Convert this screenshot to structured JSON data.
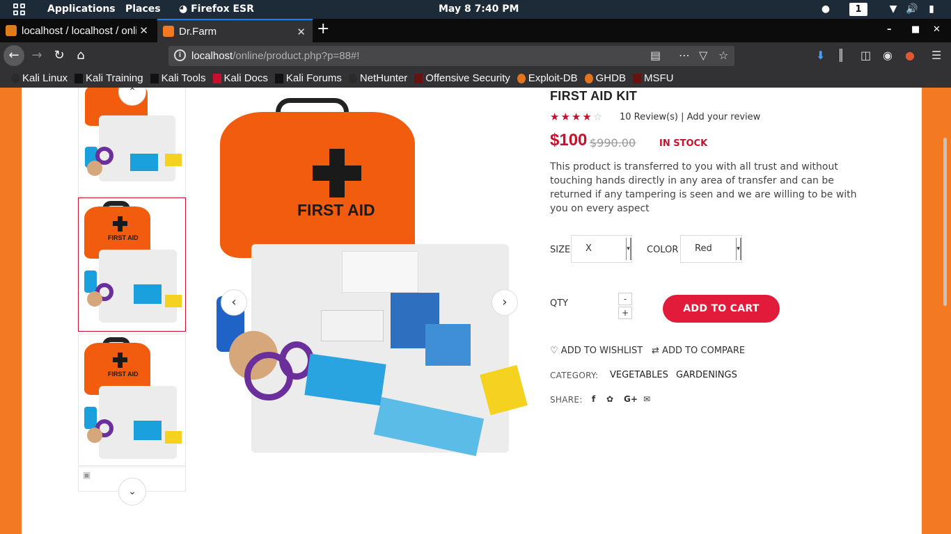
{
  "system_bar": {
    "menus": [
      "Applications",
      "Places",
      "Firefox ESR"
    ],
    "clock": "May 8   7:40 PM",
    "workspace": "1"
  },
  "browser": {
    "tabs": [
      {
        "title": "localhost / localhost / online",
        "active": false
      },
      {
        "title": "Dr.Farm",
        "active": true
      }
    ],
    "url_host": "localhost",
    "url_path": "/online/product.php?p=88#!",
    "bookmarks": [
      "Kali Linux",
      "Kali Training",
      "Kali Tools",
      "Kali Docs",
      "Kali Forums",
      "NetHunter",
      "Offensive Security",
      "Exploit-DB",
      "GHDB",
      "MSFU"
    ]
  },
  "product": {
    "title": "FIRST AID KIT",
    "rating": 4,
    "rating_max": 5,
    "reviews_text": "10 Review(s) | Add your review",
    "price": "$100",
    "old_price": "$990.00",
    "stock": "IN STOCK",
    "description": "This product is transferred to you with all trust and without touching hands directly in any area of transfer and can be returned if any tampering is seen and we are willing to be with you on every aspect",
    "image_label": "FIRST AID",
    "size_label": "SIZE",
    "size_value": "X",
    "color_label": "COLOR",
    "color_value": "Red",
    "qty_label": "QTY",
    "qty_minus": "-",
    "qty_plus": "+",
    "add_to_cart": "ADD TO CART",
    "wishlist": "ADD TO WISHLIST",
    "compare": "ADD TO COMPARE",
    "category_label": "CATEGORY:",
    "categories": [
      "VEGETABLES",
      "GARDENINGS"
    ],
    "share_label": "SHARE:"
  },
  "colors": {
    "accent": "#e31b3a",
    "page_bg": "#f37a23",
    "bag": "#f25c0f"
  }
}
